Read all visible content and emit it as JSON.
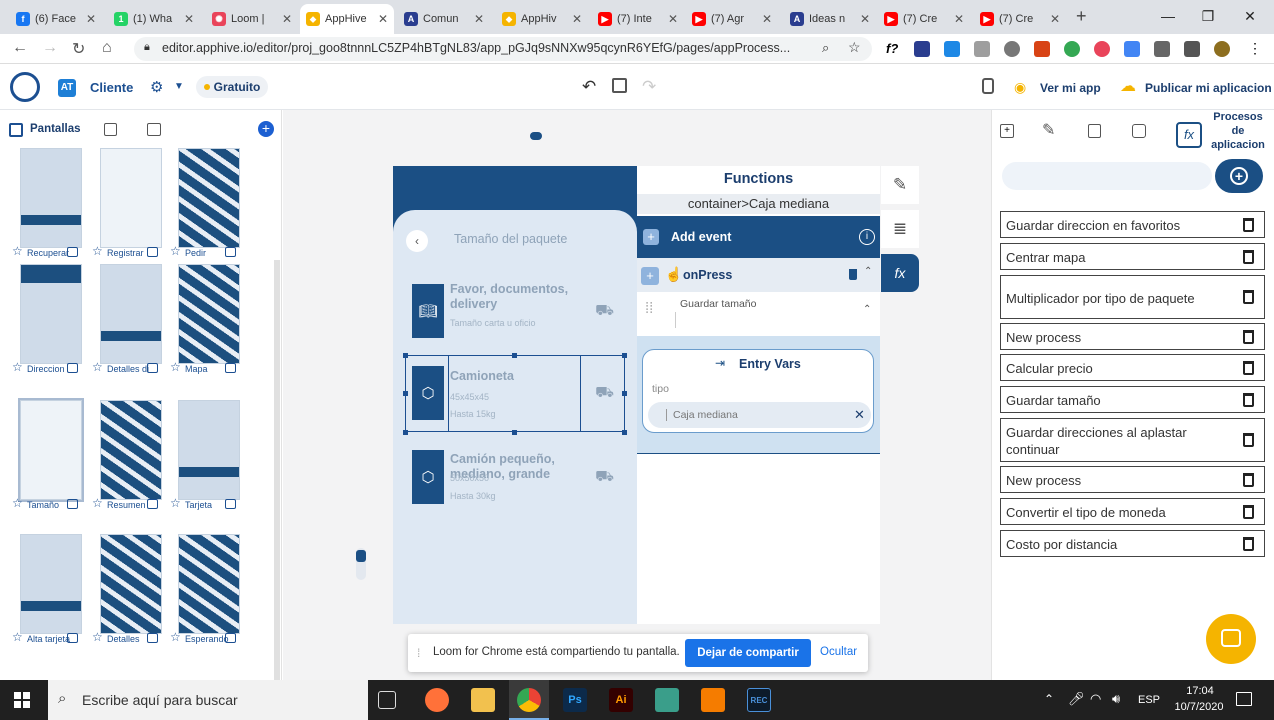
{
  "browser": {
    "tabs": [
      {
        "title": "(6) Face",
        "favicon": "facebook-icon",
        "color": "#1877f2",
        "glyph": "f"
      },
      {
        "title": "(1) Wha",
        "favicon": "whatsapp-icon",
        "color": "#25d366",
        "glyph": "1"
      },
      {
        "title": "Loom |",
        "favicon": "loom-icon",
        "color": "#e9445a",
        "glyph": "✺"
      },
      {
        "title": "AppHive",
        "favicon": "apphive-icon",
        "color": "#f5b400",
        "glyph": "⬥"
      },
      {
        "title": "Comun",
        "favicon": "apphive-community-icon",
        "color": "#2a3d8f",
        "glyph": "A"
      },
      {
        "title": "AppHiv",
        "favicon": "apphive-icon",
        "color": "#f5b400",
        "glyph": "⬥"
      },
      {
        "title": "(7) Inte",
        "favicon": "youtube-icon",
        "color": "#ff0000",
        "glyph": "▶"
      },
      {
        "title": "(7) Agr",
        "favicon": "youtube-icon",
        "color": "#ff0000",
        "glyph": "▶"
      },
      {
        "title": "Ideas n",
        "favicon": "apphive-community-icon",
        "color": "#2a3d8f",
        "glyph": "A"
      },
      {
        "title": "(7) Cre",
        "favicon": "youtube-icon",
        "color": "#ff0000",
        "glyph": "▶"
      },
      {
        "title": "(7) Cre",
        "favicon": "youtube-icon",
        "color": "#ff0000",
        "glyph": "▶"
      }
    ],
    "url": "editor.apphive.io/editor/proj_goo8tnnnLC5ZP4hBTgNL83/app_pGJq9sNNXw95qcynR6YEfG/pages/appProcess..."
  },
  "header": {
    "app_name": "Cliente",
    "plan_badge": "Gratuito",
    "view_app": "Ver mi app",
    "publish": "Publicar mi aplicacion"
  },
  "left_panel": {
    "screens_label": "Pantallas",
    "screens": [
      {
        "label": "Recuperar",
        "dark": "bottom"
      },
      {
        "label": "Registrar",
        "dark": "none"
      },
      {
        "label": "Pedir",
        "dark": "map"
      },
      {
        "label": "Direccion",
        "dark": "top"
      },
      {
        "label": "Detalles di",
        "dark": "bottom"
      },
      {
        "label": "Mapa",
        "dark": "map"
      },
      {
        "label": "Tamaño",
        "dark": "none"
      },
      {
        "label": "Resumen",
        "dark": "map"
      },
      {
        "label": "Tarjeta",
        "dark": "bottom"
      },
      {
        "label": "Alta tarjeta",
        "dark": "bottom"
      },
      {
        "label": "Detalles",
        "dark": "map"
      },
      {
        "label": "Esperando",
        "dark": "map"
      }
    ]
  },
  "phone": {
    "title": "Tamaño del paquete",
    "packages": [
      {
        "title": "Favor, documentos, delivery",
        "sub1": "Tamaño carta u oficio",
        "sub2": ""
      },
      {
        "title": "Camioneta",
        "sub1": "45x45x45",
        "sub2": "Hasta 15kg"
      },
      {
        "title": "Camión pequeño, mediano, grande",
        "sub1": "50x50x50",
        "sub2": "Hasta 30kg"
      }
    ]
  },
  "functions": {
    "title": "Functions",
    "breadcrumb": "container>Caja mediana",
    "add_event": "Add event",
    "event_name": "onPress",
    "process_name": "Guardar tamaño",
    "entry_vars_title": "Entry Vars",
    "var_name": "tipo",
    "var_value": "Caja mediana"
  },
  "right_panel": {
    "title": "Procesos de aplicacion",
    "search_value": "",
    "processes": [
      "Guardar direccion en favoritos",
      "Centrar mapa",
      "Multiplicador por tipo de paquete",
      "New process",
      "Calcular precio",
      "Guardar tamaño",
      "Guardar direcciones al aplastar continuar",
      "New process",
      "Convertir el tipo de moneda",
      "Costo por distancia"
    ]
  },
  "loom_bar": {
    "message": "Loom for Chrome está compartiendo tu pantalla.",
    "stop_button": "Dejar de compartir",
    "hide_button": "Ocultar"
  },
  "taskbar": {
    "search_placeholder": "Escribe aquí para buscar",
    "language": "ESP",
    "time": "17:04",
    "date": "10/7/2020"
  },
  "colors": {
    "brand": "#1c4f91",
    "phone_primary": "#1b4f84",
    "accent_yellow": "#f5b400",
    "loom_button": "#1a73e8"
  }
}
